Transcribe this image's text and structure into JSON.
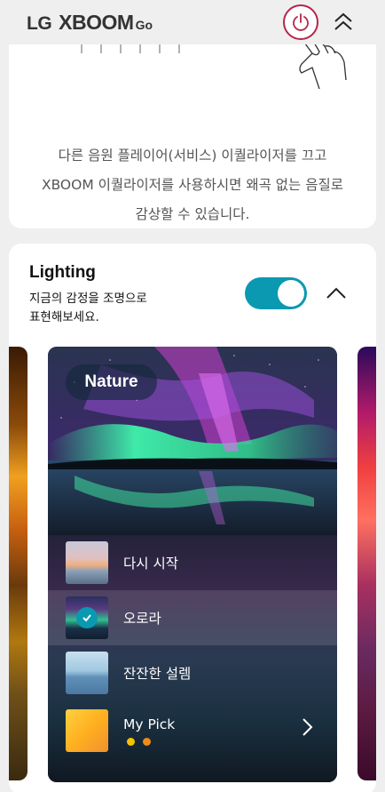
{
  "header": {
    "logo_lg": "LG",
    "logo_xboom": "XBOOM",
    "logo_go": "Go",
    "power_icon": "power-icon",
    "collapse_icon": "double-chevron-up-icon",
    "power_color": "#b5264b"
  },
  "eq_card": {
    "description_lines": [
      "다른 음원 플레이어(서비스) 이퀄라이저를 끄고",
      "XBOOM 이퀄라이저를 사용하시면 왜곡 없는 음질로",
      "감상할 수 있습니다."
    ],
    "hand_icon": "pointing-hand-icon"
  },
  "lighting": {
    "title": "Lighting",
    "subtitle_lines": [
      "지금의 감정을 조명으로",
      "표현해보세요."
    ],
    "toggle_on": true,
    "accent": "#0a99b0",
    "collapse_icon": "chevron-up-icon",
    "theme_card": {
      "name": "Nature",
      "items": [
        {
          "label": "다시 시작",
          "selected": false
        },
        {
          "label": "오로라",
          "selected": true
        },
        {
          "label": "잔잔한 설렘",
          "selected": false
        },
        {
          "label": "My Pick",
          "selected": false,
          "dot_colors": [
            "#f5c400",
            "#f08a1a"
          ],
          "chevron_icon": "chevron-right-icon"
        }
      ]
    }
  }
}
